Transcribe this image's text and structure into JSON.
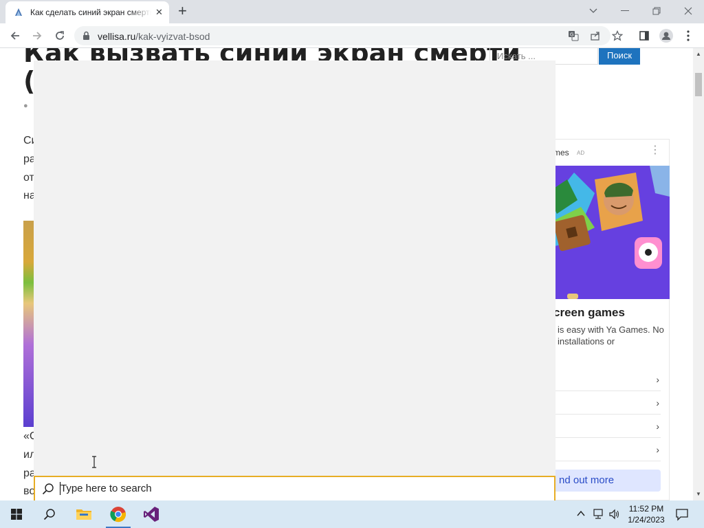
{
  "browser": {
    "tab_title": "Как сделать синий экран смерти",
    "url_domain": "vellisa.ru",
    "url_path": "/kak-vyizvat-bsod"
  },
  "article": {
    "title_line1": "Как вызвать синий экран смерти",
    "title_line2": "(",
    "text_fragments": [
      "Си",
      "ра",
      "от",
      "на",
      "«С",
      "ил",
      "ра",
      "во"
    ]
  },
  "sidebar": {
    "search_placeholder": "Искать ...",
    "search_button": "Поиск"
  },
  "ad": {
    "brand": "mes",
    "tag": "AD",
    "headline": "creen games",
    "body": "is easy with Ya Games. No installations or",
    "cta": "nd out more",
    "image_colors": {
      "background": "#6640e0"
    }
  },
  "search": {
    "placeholder": "Type here to search"
  },
  "taskbar": {
    "time": "11:52 PM",
    "date": "1/24/2023",
    "apps": [
      "start-button",
      "search",
      "file-explorer",
      "google-chrome",
      "visual-studio"
    ]
  },
  "colors": {
    "accent_search_border": "#e7ad24",
    "taskbar": "#d8e8f4",
    "search_button": "#1e73be",
    "tabstrip": "#dee1e6"
  }
}
